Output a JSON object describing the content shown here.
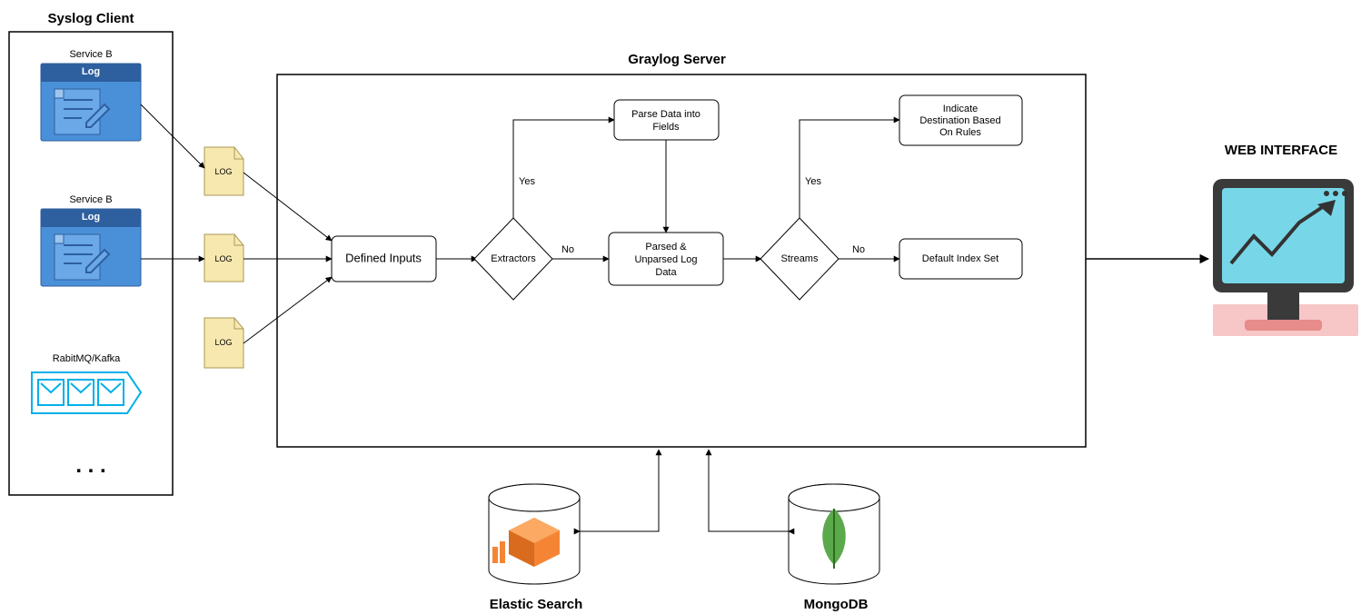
{
  "syslog_client": {
    "title": "Syslog Client",
    "serviceA_label": "Service B",
    "serviceA_log": "Log",
    "serviceB_label": "Service B",
    "serviceB_log": "Log",
    "rabbitmq_label": "RabitMQ/Kafka",
    "ellipsis": ". . .",
    "logfile1": "LOG",
    "logfile2": "LOG",
    "logfile3": "LOG"
  },
  "graylog": {
    "title": "Graylog Server",
    "defined_inputs": "Defined Inputs",
    "extractors": "Extractors",
    "parse_fields_l1": "Parse Data into",
    "parse_fields_l2": "Fields",
    "parsed_l1": "Parsed &",
    "parsed_l2": "Unparsed Log",
    "parsed_l3": "Data",
    "streams": "Streams",
    "indicate_l1": "Indicate",
    "indicate_l2": "Destination Based",
    "indicate_l3": "On Rules",
    "default_index": "Default Index Set",
    "yes1": "Yes",
    "no1": "No",
    "yes2": "Yes",
    "no2": "No"
  },
  "web_interface": "WEB INTERFACE",
  "elastic": "Elastic Search",
  "mongo": "MongoDB"
}
